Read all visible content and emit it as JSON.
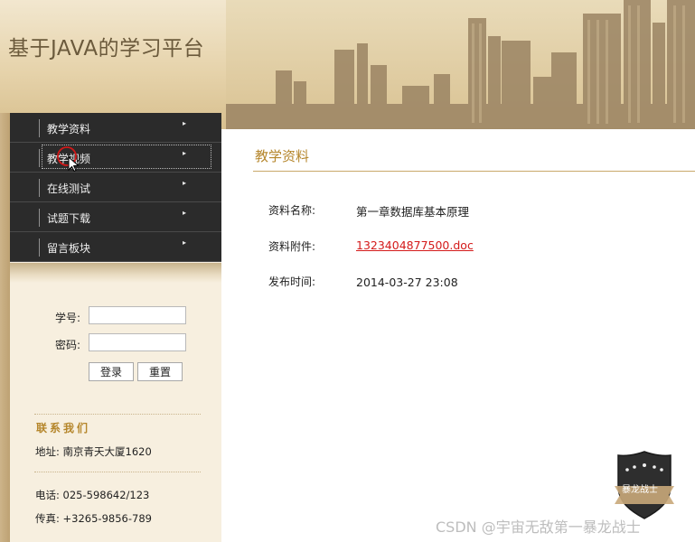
{
  "header": {
    "title": "基于JAVA的学习平台"
  },
  "menu": {
    "items": [
      {
        "label": "教学资料",
        "arrow": "▸"
      },
      {
        "label": "教学视频",
        "arrow": "▸"
      },
      {
        "label": "在线测试",
        "arrow": "▸"
      },
      {
        "label": "试题下载",
        "arrow": "▸"
      },
      {
        "label": "留言板块",
        "arrow": "▸"
      }
    ]
  },
  "login": {
    "student_id_label": "学号:",
    "student_id_value": "",
    "password_label": "密码:",
    "password_value": "",
    "login_button": "登录",
    "reset_button": "重置"
  },
  "contact": {
    "title": "联系我们",
    "address": "地址: 南京青天大厦1620",
    "phone": "电话: 025-598642/123",
    "fax": "传真: +3265-9856-789"
  },
  "main": {
    "title": "教学资料",
    "fields": [
      {
        "label": "资料名称:",
        "value": "第一章数据库基本原理"
      },
      {
        "label": "资料附件:",
        "value": "1323404877500.doc"
      },
      {
        "label": "发布时间:",
        "value": "2014-03-27 23:08"
      }
    ]
  },
  "badge": {
    "text": "暴龙战士"
  },
  "watermark": "CSDN @宇宙无敌第一暴龙战士",
  "colors": {
    "accent": "#b5862b",
    "menu_bg": "#2b2b2b",
    "link": "#d41a1a"
  },
  "icons": {
    "menu_arrow": "triangle-right-icon",
    "cursor": "mouse-pointer-icon"
  }
}
